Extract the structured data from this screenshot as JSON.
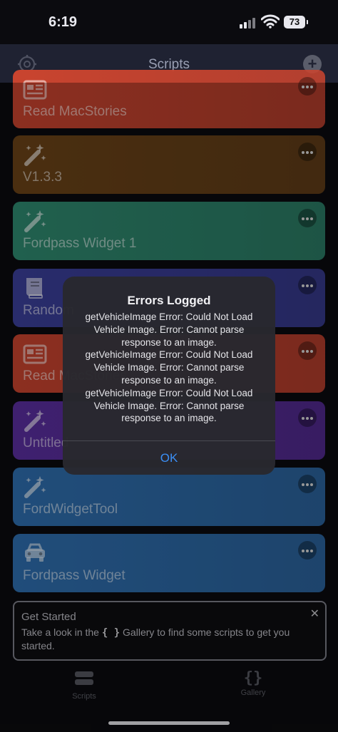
{
  "status": {
    "time": "6:19",
    "battery": "73"
  },
  "nav": {
    "title": "Scripts"
  },
  "scripts": [
    {
      "name": "Read MacStories",
      "icon": "newspaper-icon",
      "color": "#c9442f"
    },
    {
      "name": "V1.3.3",
      "icon": "magic-wand-icon",
      "color": "#6b4318"
    },
    {
      "name": "Fordpass Widget 1",
      "icon": "magic-wand-icon",
      "color": "#2f8a70"
    },
    {
      "name": "Random",
      "icon": "book-icon",
      "color": "#3b3f9b"
    },
    {
      "name": "Read MacStories",
      "icon": "newspaper-icon",
      "color": "#c9442f"
    },
    {
      "name": "Untitled",
      "icon": "magic-wand-icon",
      "color": "#5b2ea0"
    },
    {
      "name": "FordWidgetTool",
      "icon": "magic-wand-icon",
      "color": "#2f6fb0"
    },
    {
      "name": "Fordpass Widget",
      "icon": "car-icon",
      "color": "#2f6fb0"
    }
  ],
  "get_started": {
    "title": "Get Started",
    "body_before": "Take a look in the ",
    "body_symbol": "{ }",
    "body_after": " Gallery to find some scripts to get you started."
  },
  "tabs": [
    {
      "label": "Scripts",
      "icon": "stack-icon"
    },
    {
      "label": "Gallery",
      "icon": "braces-icon"
    }
  ],
  "alert": {
    "title": "Errors Logged",
    "message_lines": [
      "getVehicleImage Error: Could Not Load",
      "Vehicle Image. Error: Cannot parse",
      "response to an image.",
      "getVehicleImage Error: Could Not Load",
      "Vehicle Image. Error: Cannot parse",
      "response to an image.",
      "getVehicleImage Error: Could Not Load",
      "Vehicle Image. Error: Cannot parse",
      "response to an image."
    ],
    "button": "OK"
  }
}
